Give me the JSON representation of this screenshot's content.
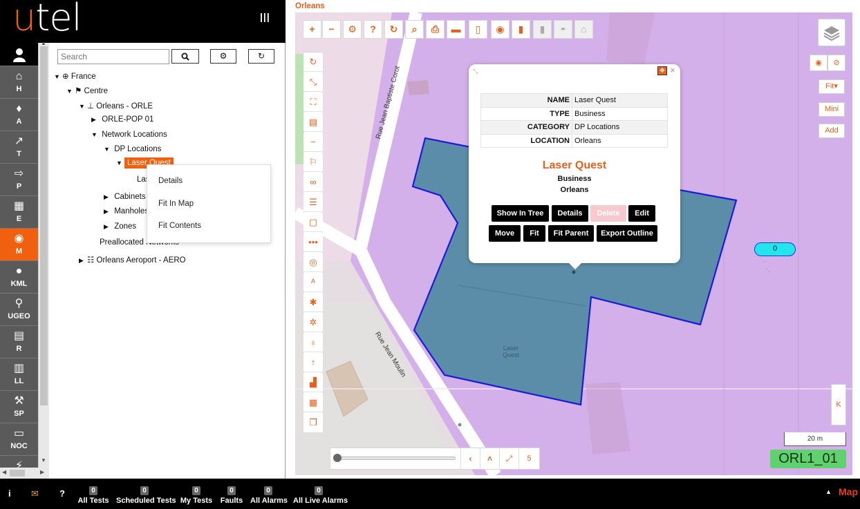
{
  "logo": {
    "u": "u",
    "tel": "tel"
  },
  "nav": {
    "items": [
      {
        "icon": "⌂",
        "label": "H"
      },
      {
        "icon": "🔔",
        "label": "A"
      },
      {
        "icon": "📈",
        "label": "T"
      },
      {
        "icon": "⇪",
        "label": "P"
      },
      {
        "icon": "▦",
        "label": "E"
      },
      {
        "icon": "🌐",
        "label": "M"
      },
      {
        "icon": "⚲",
        "label": "KML"
      },
      {
        "icon": "⚲",
        "label": "UGEO"
      },
      {
        "icon": "▤",
        "label": "R"
      },
      {
        "icon": "▥",
        "label": "LL"
      },
      {
        "icon": "🔧",
        "label": "SP"
      },
      {
        "icon": "▭",
        "label": "NOC"
      },
      {
        "icon": "⚡",
        "label": ""
      }
    ]
  },
  "tree": {
    "search_placeholder": "Search",
    "nodes": {
      "france": "France",
      "centre": "Centre",
      "orleans": "Orleans - ORLE",
      "orle_pop": "ORLE-POP 01",
      "netloc": "Network Locations",
      "dploc": "DP Locations",
      "laserquest": "Laser Quest",
      "las": "Las",
      "cabinets": "Cabinets",
      "manholes": "Manholes",
      "zones": "Zones",
      "prealloc": "Preallocated Networks",
      "aero": "Orleans Aeroport - AERO"
    },
    "context_menu": [
      "Details",
      "Fit In Map",
      "Fit Contents"
    ]
  },
  "map": {
    "title": "Orleans",
    "streets": {
      "s1": "Rue Jean Baptiste Corot",
      "s2": "Rue Jean Moulin"
    },
    "polygon_label_1": "Laser",
    "polygon_label_2": "Quest",
    "right_controls": {
      "fit": "Fit▾",
      "mini": "Mini",
      "add": "Add",
      "k": "K"
    },
    "cyan_badge": "0",
    "scale": "20 m",
    "site_badge": "ORL1_01",
    "slider_value": "5"
  },
  "popup": {
    "rows": [
      {
        "k": "NAME",
        "v": "Laser Quest"
      },
      {
        "k": "TYPE",
        "v": "Business"
      },
      {
        "k": "CATEGORY",
        "v": "DP Locations"
      },
      {
        "k": "LOCATION",
        "v": "Orleans"
      }
    ],
    "title": "Laser Quest",
    "type": "Business",
    "location": "Orleans",
    "buttons": {
      "show_in_tree": "Show In Tree",
      "details": "Details",
      "delete": "Delete",
      "edit": "Edit",
      "move": "Move",
      "fit": "Fit",
      "fit_parent": "Fit Parent",
      "export_outline": "Export Outline"
    }
  },
  "bottom": {
    "counters": [
      {
        "n": "0",
        "label": "All Tests"
      },
      {
        "n": "0",
        "label": "Scheduled Tests"
      },
      {
        "n": "0",
        "label": "My Tests"
      },
      {
        "n": "0",
        "label": "Faults"
      },
      {
        "n": "0",
        "label": "All Alarms"
      },
      {
        "n": "0",
        "label": "All Live Alarms"
      }
    ],
    "map_label": "Map"
  },
  "colors": {
    "accent": "#e8601c",
    "map_bg": "#d3b0e9",
    "polygon": "#5b8da8",
    "polygon_stroke": "#1a1adc",
    "site_badge": "#5fd16f",
    "cyan": "#22e5ee"
  }
}
